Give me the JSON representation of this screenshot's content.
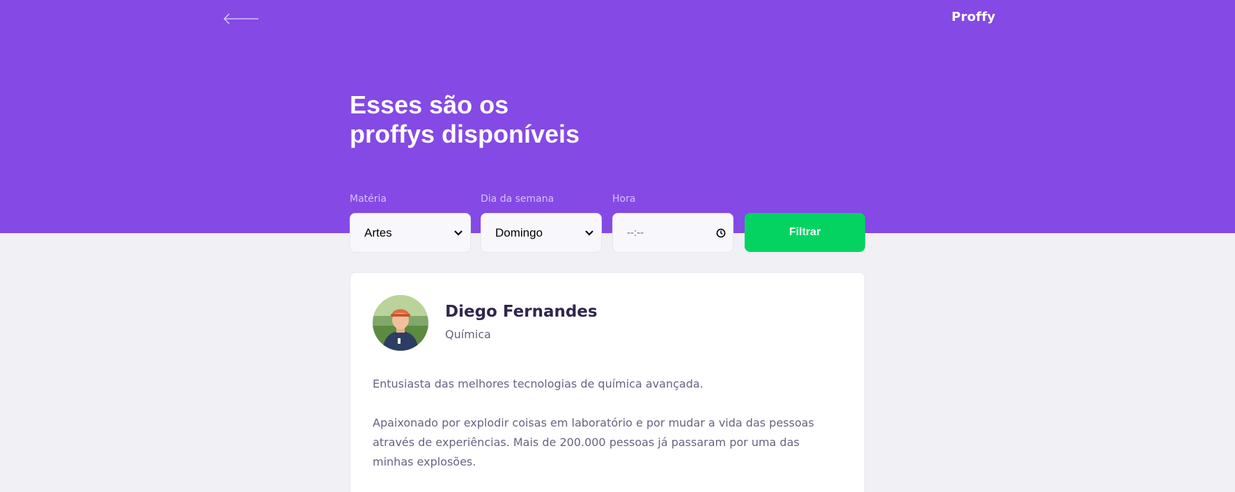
{
  "header": {
    "back_icon": "arrow-left-icon",
    "logo_text": "Proffy"
  },
  "page": {
    "title_line1": "Esses são os",
    "title_line2": "proffys disponíveis"
  },
  "filters": {
    "subject": {
      "label": "Matéria",
      "value": "Artes"
    },
    "week_day": {
      "label": "Dia da semana",
      "value": "Domingo"
    },
    "time": {
      "label": "Hora",
      "placeholder": "--:--",
      "icon": "clock-icon"
    },
    "submit_label": "Filtrar"
  },
  "teacher": {
    "name": "Diego Fernandes",
    "subject": "Química",
    "bio_paragraph1": "Entusiasta das melhores tecnologias de química avançada.",
    "bio_paragraph2": "Apaixonado por explodir coisas em laboratório e por mudar a vida das pessoas através de experiências. Mais de 200.000 pessoas já passaram por uma das minhas explosões."
  },
  "colors": {
    "primary": "#8549E5",
    "secondary": "#04D361",
    "background": "#F0F0F5",
    "title_text": "#32264D",
    "body_text": "#6A6180",
    "label_text": "#D4C2FF"
  }
}
